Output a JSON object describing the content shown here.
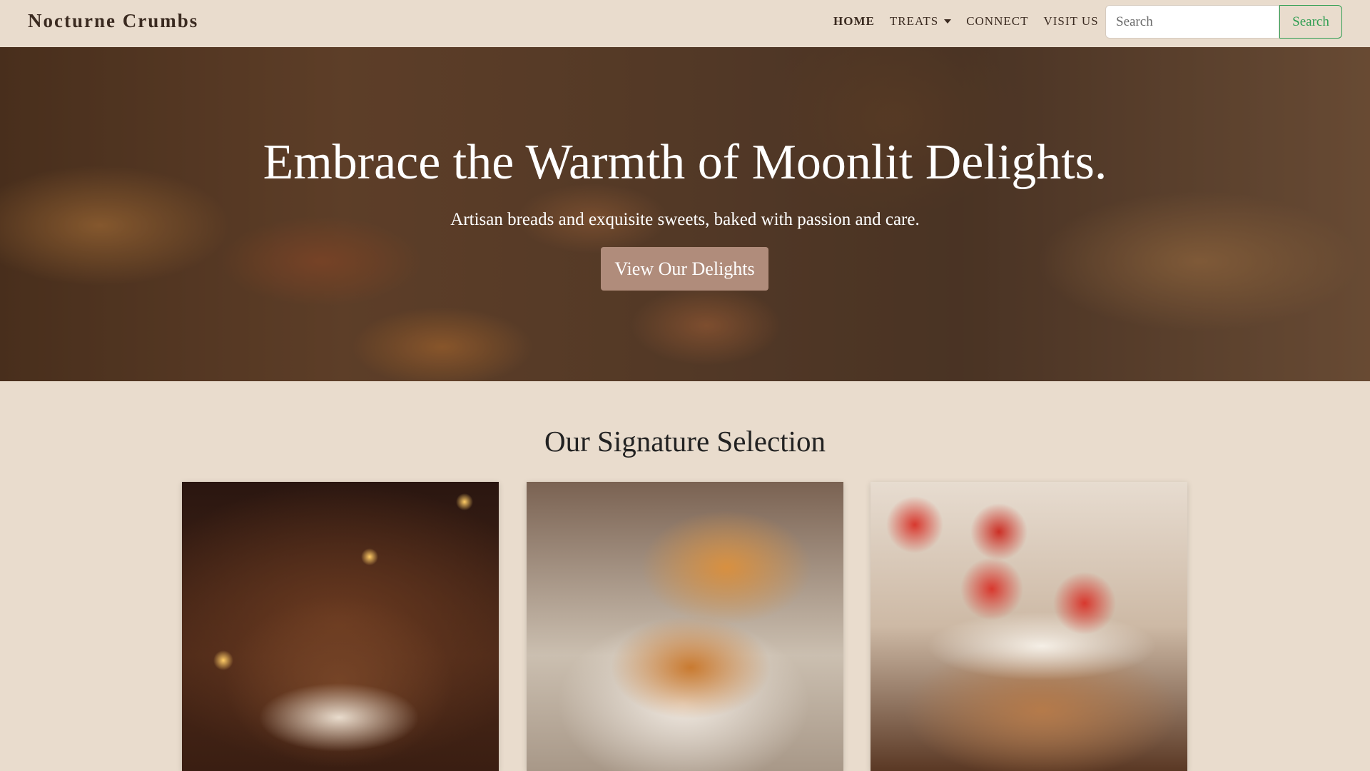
{
  "navbar": {
    "brand": "Nocturne Crumbs",
    "links": [
      {
        "label": "HOME",
        "active": true
      },
      {
        "label": "TREATS",
        "dropdown": true
      },
      {
        "label": "CONNECT"
      },
      {
        "label": "VISIT US"
      }
    ],
    "search_placeholder": "Search",
    "search_button": "Search"
  },
  "hero": {
    "title": "Embrace the Warmth of Moonlit Delights.",
    "subtitle": "Artisan breads and exquisite sweets, baked with passion and care.",
    "cta": "View Our Delights"
  },
  "selection": {
    "title": "Our Signature Selection",
    "cards": [
      {
        "image": "tiramisu-image"
      },
      {
        "image": "croissants-image"
      },
      {
        "image": "strawberry-toast-image"
      }
    ]
  },
  "colors": {
    "background": "#e9dccd",
    "accent_button": "#b08c7b",
    "search_green": "#2f9e52",
    "text_dark": "#3a2a20"
  }
}
